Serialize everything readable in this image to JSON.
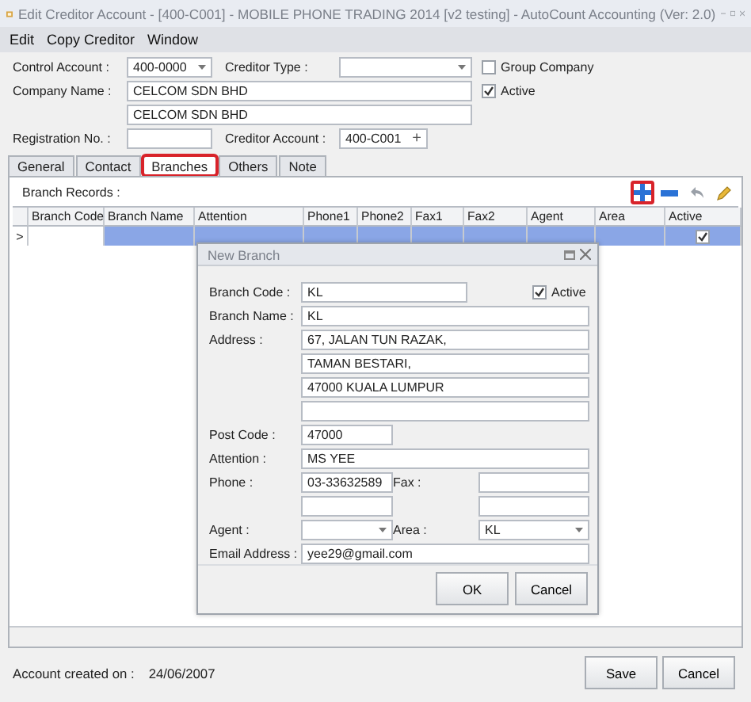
{
  "window": {
    "title": "Edit Creditor Account - [400-C001] - MOBILE PHONE TRADING 2014 [v2 testing] - AutoCount Accounting (Ver: 2.0)"
  },
  "menu": [
    "Edit",
    "Copy Creditor",
    "Window"
  ],
  "form": {
    "control_account": {
      "label": "Control Account :",
      "value": "400-0000"
    },
    "creditor_type": {
      "label": "Creditor Type :"
    },
    "group_company": {
      "label": "Group Company",
      "checked": false
    },
    "active": {
      "label": "Active",
      "checked": true
    },
    "company_name": {
      "label": "Company Name :",
      "lines": [
        "CELCOM SDN BHD",
        "CELCOM SDN BHD"
      ]
    },
    "registration_no": {
      "label": "Registration No. :"
    },
    "creditor_account": {
      "label": "Creditor Account :",
      "value": "400-C001",
      "button": "+"
    }
  },
  "tabs": [
    {
      "label": "General",
      "selected": false,
      "highlighted": false
    },
    {
      "label": "Contact",
      "selected": false,
      "highlighted": false
    },
    {
      "label": "Branches",
      "selected": true,
      "highlighted": true
    },
    {
      "label": "Others",
      "selected": false,
      "highlighted": false
    },
    {
      "label": "Note",
      "selected": false,
      "highlighted": false
    }
  ],
  "branches": {
    "label": "Branch Records :",
    "toolbar": [
      {
        "kind": "add",
        "highlighted": true
      },
      {
        "kind": "remove",
        "highlighted": false
      },
      {
        "kind": "undo",
        "highlighted": false
      },
      {
        "kind": "edit",
        "highlighted": false
      }
    ],
    "columns": [
      "Branch Code",
      "Branch Name",
      "Attention",
      "Phone1",
      "Phone2",
      "Fax1",
      "Fax2",
      "Agent",
      "Area",
      "Active"
    ],
    "rows": [
      {
        "indicator": ">",
        "selected": true,
        "active": true
      }
    ]
  },
  "dialog": {
    "title": "New Branch",
    "branch_code": {
      "label": "Branch Code :",
      "value": "KL"
    },
    "active": {
      "label": "Active",
      "checked": true
    },
    "branch_name": {
      "label": "Branch Name :",
      "value": "KL"
    },
    "address": {
      "label": "Address :",
      "lines": [
        "67, JALAN TUN RAZAK,",
        "TAMAN BESTARI,",
        "47000 KUALA LUMPUR"
      ]
    },
    "post_code": {
      "label": "Post Code :",
      "value": "47000"
    },
    "attention": {
      "label": "Attention :",
      "value": "MS YEE"
    },
    "phone": {
      "label": "Phone :",
      "value": "03-33632589"
    },
    "fax": {
      "label": "Fax :"
    },
    "agent": {
      "label": "Agent :"
    },
    "area": {
      "label": "Area :",
      "value": "KL"
    },
    "email": {
      "label": "Email Address :",
      "value": "yee29@gmail.com"
    },
    "buttons": [
      "OK",
      "Cancel"
    ]
  },
  "footer": {
    "label": "Account created on :",
    "value": "24/06/2007",
    "buttons": [
      "Save",
      "Cancel"
    ]
  }
}
